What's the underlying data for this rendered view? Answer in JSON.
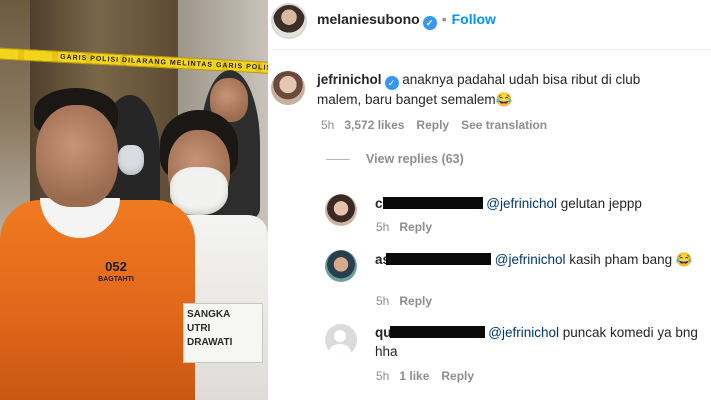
{
  "photo": {
    "tape_text": "GARIS POLISI   DILARANG MELINTAS   GARIS POLISI",
    "prisoner_tag_number": "052",
    "prisoner_tag_sub": "BAGTAHTI",
    "sign_lines": [
      "SANGKA",
      "UTRI",
      "DRAWATI"
    ]
  },
  "post": {
    "username": "melaniesubono",
    "verified_mark": "✓",
    "dot": "•",
    "follow_label": "Follow"
  },
  "comments": [
    {
      "username": "jefrinichol",
      "verified_mark": "✓",
      "text": "anaknya padahal udah bisa ribut di club malem, baru banget semalem😂",
      "time": "5h",
      "likes": "3,572 likes",
      "reply_label": "Reply",
      "translate_label": "See translation"
    }
  ],
  "view_replies_label": "View replies (63)",
  "replies": [
    {
      "username_visible": "cin",
      "mention": "@jefrinichol",
      "text": "gelutan jeppp",
      "time": "5h",
      "reply_label": "Reply"
    },
    {
      "username_visible": "as",
      "mention": "@jefrinichol",
      "text": "kasih pham bang 😂",
      "time": "5h",
      "reply_label": "Reply"
    },
    {
      "username_visible": "qu",
      "mention": "@jefrinichol",
      "text": "puncak komedi ya bng hha",
      "time": "5h",
      "likes": "1 like",
      "reply_label": "Reply"
    }
  ]
}
